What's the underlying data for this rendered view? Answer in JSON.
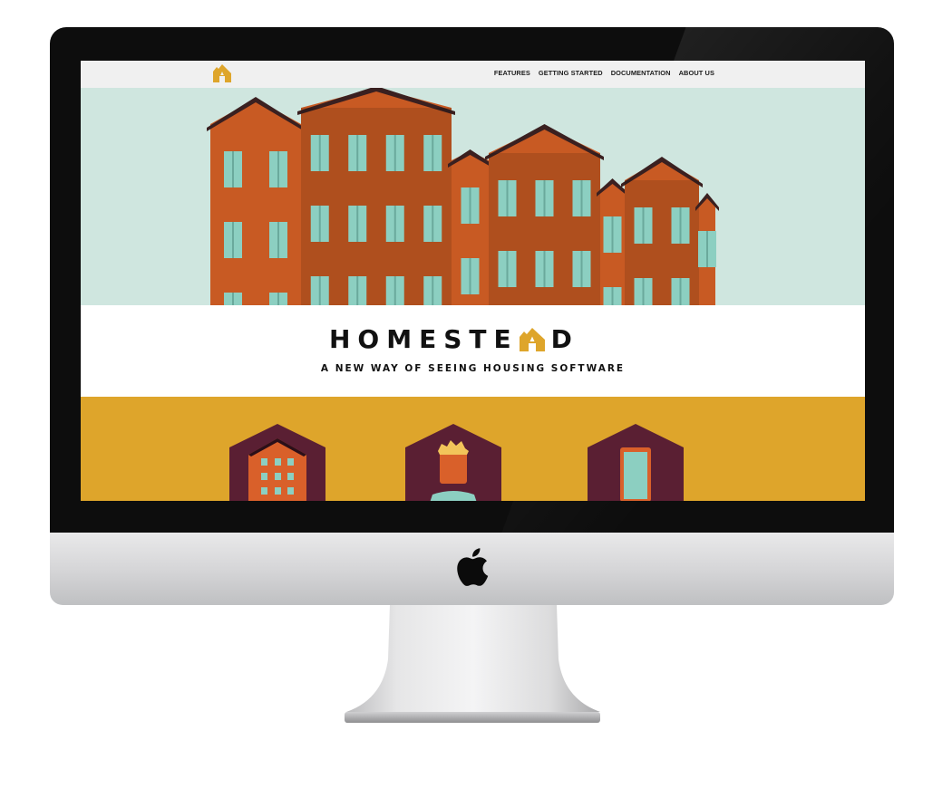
{
  "brand": {
    "name": "HOMESTEAD",
    "name_left": "HOMESTE",
    "name_right": "D",
    "tagline": "A NEW WAY OF SEEING HOUSING SOFTWARE"
  },
  "nav": {
    "items": [
      {
        "label": "FEATURES"
      },
      {
        "label": "GETTING STARTED"
      },
      {
        "label": "DOCUMENTATION"
      },
      {
        "label": "ABOUT US"
      }
    ]
  },
  "colors": {
    "hero_bg": "#cfe6df",
    "brick": "#c85a23",
    "accent_gold": "#dea52b",
    "plum": "#5a1f33",
    "window": "#8ccfc1"
  },
  "features": [
    {
      "icon": "apartment-building-icon"
    },
    {
      "icon": "person-icon"
    },
    {
      "icon": "door-icon"
    }
  ],
  "device": {
    "logo_icon": "apple-logo-icon"
  }
}
